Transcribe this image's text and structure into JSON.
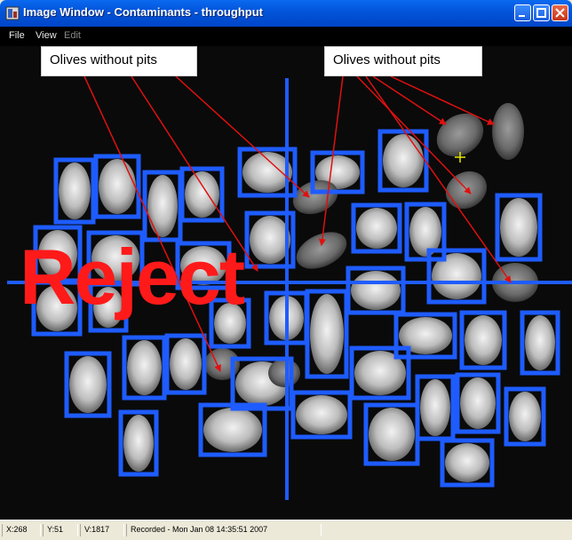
{
  "window": {
    "title": "Image Window - Contaminants - throughput"
  },
  "menu": {
    "items": [
      {
        "label": "File",
        "enabled": true
      },
      {
        "label": "View",
        "enabled": true
      },
      {
        "label": "Edit",
        "enabled": false
      }
    ]
  },
  "callouts": [
    "Olives without pits",
    "Olives without pits"
  ],
  "overlay": {
    "reject_label": "Reject"
  },
  "status": {
    "x": "X:268",
    "y": "Y:51",
    "v": "V:1817",
    "recorded": "Recorded - Mon Jan 08 14:35:51 2007"
  },
  "colors": {
    "box": "#1e5cff",
    "arrow": "#e01010",
    "reject": "#ff1a1a",
    "cursor": "#e8e800"
  }
}
